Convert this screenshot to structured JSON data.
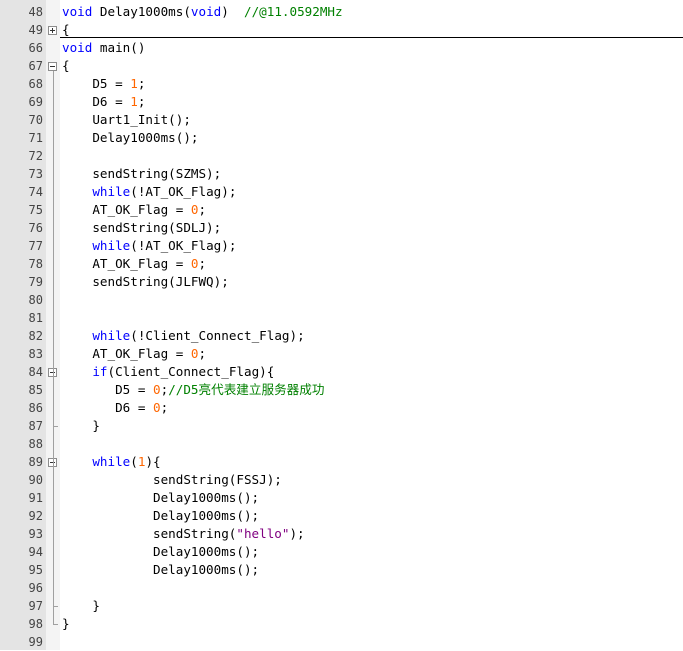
{
  "editor": {
    "lines": [
      {
        "n": "48",
        "fold": null,
        "parts": [
          [
            "kw",
            "void"
          ],
          [
            "t",
            " Delay1000ms("
          ],
          [
            "kw",
            "void"
          ],
          [
            "t",
            ")  "
          ],
          [
            "com",
            "//@11.0592MHz"
          ]
        ]
      },
      {
        "n": "49",
        "fold": "plus",
        "parts": [
          [
            "t",
            "{"
          ]
        ]
      },
      {
        "n": "66",
        "fold": null,
        "parts": [
          [
            "kw",
            "void"
          ],
          [
            "t",
            " main()"
          ]
        ]
      },
      {
        "n": "67",
        "fold": "minus",
        "parts": [
          [
            "t",
            "{"
          ]
        ]
      },
      {
        "n": "68",
        "fold": null,
        "parts": [
          [
            "t",
            "    D5 = "
          ],
          [
            "num",
            "1"
          ],
          [
            "t",
            ";"
          ]
        ]
      },
      {
        "n": "69",
        "fold": null,
        "parts": [
          [
            "t",
            "    D6 = "
          ],
          [
            "num",
            "1"
          ],
          [
            "t",
            ";"
          ]
        ]
      },
      {
        "n": "70",
        "fold": null,
        "parts": [
          [
            "t",
            "    Uart1_Init();"
          ]
        ]
      },
      {
        "n": "71",
        "fold": null,
        "parts": [
          [
            "t",
            "    Delay1000ms();"
          ]
        ]
      },
      {
        "n": "72",
        "fold": null,
        "parts": []
      },
      {
        "n": "73",
        "fold": null,
        "parts": [
          [
            "t",
            "    sendString(SZMS);"
          ]
        ]
      },
      {
        "n": "74",
        "fold": null,
        "parts": [
          [
            "t",
            "    "
          ],
          [
            "kw",
            "while"
          ],
          [
            "t",
            "(!AT_OK_Flag);"
          ]
        ]
      },
      {
        "n": "75",
        "fold": null,
        "parts": [
          [
            "t",
            "    AT_OK_Flag = "
          ],
          [
            "num",
            "0"
          ],
          [
            "t",
            ";"
          ]
        ]
      },
      {
        "n": "76",
        "fold": null,
        "parts": [
          [
            "t",
            "    sendString(SDLJ);"
          ]
        ]
      },
      {
        "n": "77",
        "fold": null,
        "parts": [
          [
            "t",
            "    "
          ],
          [
            "kw",
            "while"
          ],
          [
            "t",
            "(!AT_OK_Flag);"
          ]
        ]
      },
      {
        "n": "78",
        "fold": null,
        "parts": [
          [
            "t",
            "    AT_OK_Flag = "
          ],
          [
            "num",
            "0"
          ],
          [
            "t",
            ";"
          ]
        ]
      },
      {
        "n": "79",
        "fold": null,
        "parts": [
          [
            "t",
            "    sendString(JLFWQ);"
          ]
        ]
      },
      {
        "n": "80",
        "fold": null,
        "parts": []
      },
      {
        "n": "81",
        "fold": null,
        "parts": []
      },
      {
        "n": "82",
        "fold": null,
        "parts": [
          [
            "t",
            "    "
          ],
          [
            "kw",
            "while"
          ],
          [
            "t",
            "(!Client_Connect_Flag);"
          ]
        ]
      },
      {
        "n": "83",
        "fold": null,
        "parts": [
          [
            "t",
            "    AT_OK_Flag = "
          ],
          [
            "num",
            "0"
          ],
          [
            "t",
            ";"
          ]
        ]
      },
      {
        "n": "84",
        "fold": "minus",
        "parts": [
          [
            "t",
            "    "
          ],
          [
            "kw",
            "if"
          ],
          [
            "t",
            "(Client_Connect_Flag){"
          ]
        ]
      },
      {
        "n": "85",
        "fold": null,
        "parts": [
          [
            "t",
            "       D5 = "
          ],
          [
            "num",
            "0"
          ],
          [
            "t",
            ";"
          ],
          [
            "com",
            "//D5亮代表建立服务器成功"
          ]
        ]
      },
      {
        "n": "86",
        "fold": null,
        "parts": [
          [
            "t",
            "       D6 = "
          ],
          [
            "num",
            "0"
          ],
          [
            "t",
            ";"
          ]
        ]
      },
      {
        "n": "87",
        "fold": "end",
        "parts": [
          [
            "t",
            "    }"
          ]
        ]
      },
      {
        "n": "88",
        "fold": null,
        "parts": []
      },
      {
        "n": "89",
        "fold": "minus",
        "parts": [
          [
            "t",
            "    "
          ],
          [
            "kw",
            "while"
          ],
          [
            "t",
            "("
          ],
          [
            "num",
            "1"
          ],
          [
            "t",
            "){"
          ]
        ]
      },
      {
        "n": "90",
        "fold": null,
        "parts": [
          [
            "t",
            "            sendString(FSSJ);"
          ]
        ]
      },
      {
        "n": "91",
        "fold": null,
        "parts": [
          [
            "t",
            "            Delay1000ms();"
          ]
        ]
      },
      {
        "n": "92",
        "fold": null,
        "parts": [
          [
            "t",
            "            Delay1000ms();"
          ]
        ]
      },
      {
        "n": "93",
        "fold": null,
        "parts": [
          [
            "t",
            "            sendString("
          ],
          [
            "str",
            "\"hello\""
          ],
          [
            "t",
            ");"
          ]
        ]
      },
      {
        "n": "94",
        "fold": null,
        "parts": [
          [
            "t",
            "            Delay1000ms();"
          ]
        ]
      },
      {
        "n": "95",
        "fold": null,
        "parts": [
          [
            "t",
            "            Delay1000ms();"
          ]
        ]
      },
      {
        "n": "96",
        "fold": null,
        "parts": []
      },
      {
        "n": "97",
        "fold": "end",
        "parts": [
          [
            "t",
            "    }"
          ]
        ]
      },
      {
        "n": "98",
        "fold": "end",
        "parts": [
          [
            "t",
            "}"
          ]
        ]
      },
      {
        "n": "99",
        "fold": null,
        "parts": []
      }
    ]
  },
  "colors": {
    "keyword": "#0000ff",
    "number": "#ff6600",
    "comment": "#008000",
    "string": "#800080",
    "gutter": "#e4e4e4"
  }
}
